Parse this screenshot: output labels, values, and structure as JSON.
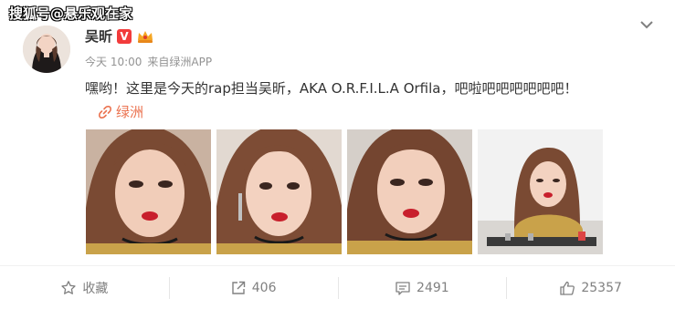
{
  "watermark": "搜狐号@悬乐观在家",
  "post": {
    "username": "吴昕",
    "verified_badge": "V",
    "timestamp": "今天 10:00",
    "source_prefix": "来自",
    "source": "绿洲APP",
    "text": "嘿哟！这里是今天的rap担当吴昕，AKA O.R.F.I.L.A Orfila，吧啦吧吧吧吧吧吧！",
    "location": "绿洲",
    "photos": [
      "photo-1",
      "photo-2",
      "photo-3",
      "photo-4"
    ]
  },
  "actions": {
    "favorite_label": "收藏",
    "share_count": "406",
    "comment_count": "2491",
    "like_count": "25357"
  },
  "colors": {
    "accent": "#eb7350",
    "verified": "#f23b3b",
    "muted": "#939393"
  }
}
